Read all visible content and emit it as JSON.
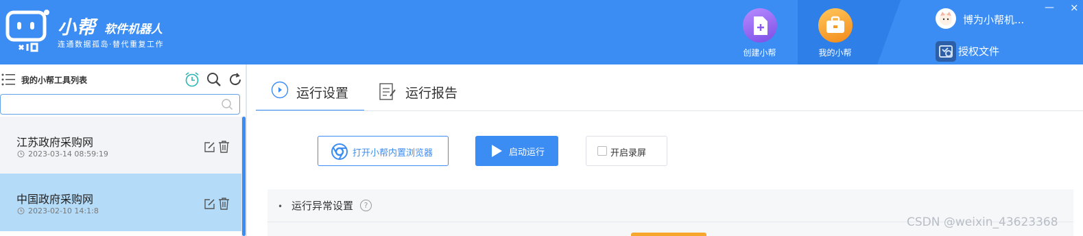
{
  "brand": {
    "title": "小帮",
    "subtitle": "软件机器人",
    "slogan": "连通数据孤岛·替代重复工作"
  },
  "nav": {
    "create_label": "创建小帮",
    "mine_label": "我的小帮"
  },
  "user": {
    "name": "博为小帮机...",
    "license_label": "授权文件"
  },
  "window": {
    "minimize": "—",
    "close": "×"
  },
  "sidebar": {
    "title": "我的小帮工具列表",
    "search_placeholder": "",
    "items": [
      {
        "name": "江苏政府采购网",
        "time": "2023-03-14 08:59:19"
      },
      {
        "name": "中国政府采购网",
        "time": "2023-02-10 14:1:8"
      }
    ]
  },
  "tabs": {
    "run_settings": "运行设置",
    "run_report": "运行报告"
  },
  "actions": {
    "open_browser": "打开小帮内置浏览器",
    "start_run": "启动运行",
    "record_screen": "开启录屏"
  },
  "settings": {
    "bullet": "•",
    "exception_title": "运行异常设置",
    "help": "?"
  },
  "watermark": "CSDN @weixin_43623368",
  "colors": {
    "header_blue": "#3b8cf3",
    "selected_item": "#b4dbf7",
    "accent_orange": "#f7a72c"
  }
}
